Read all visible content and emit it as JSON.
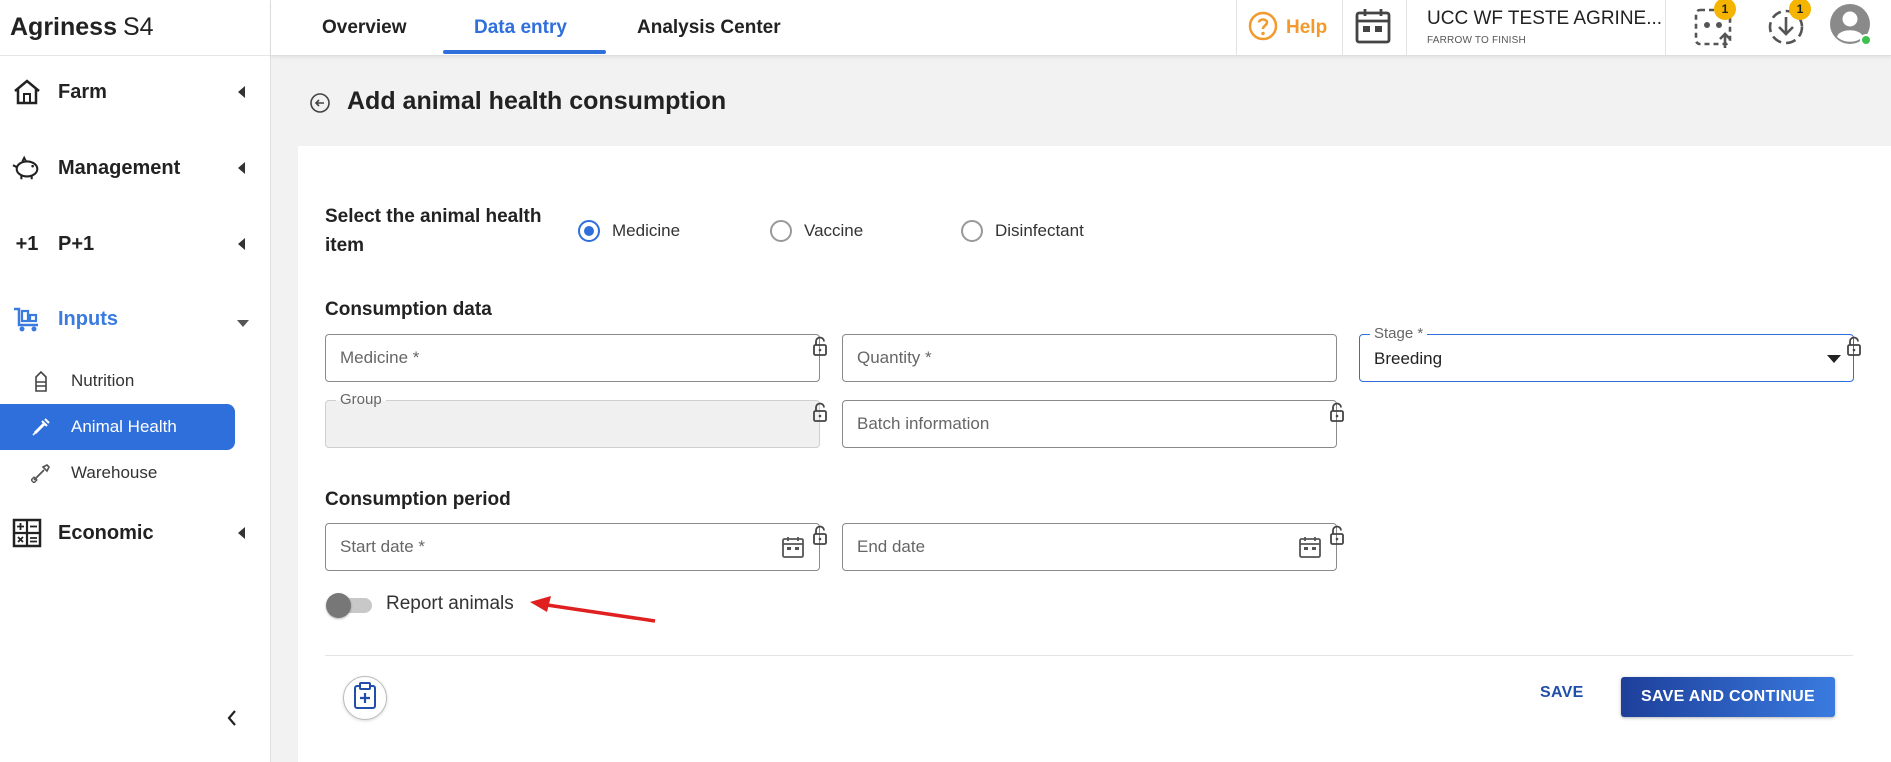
{
  "brand": {
    "name": "Agriness",
    "suffix": "S4"
  },
  "sidebar": {
    "items": [
      {
        "label": "Farm",
        "icon": "house-icon"
      },
      {
        "label": "Management",
        "icon": "pig-icon"
      },
      {
        "label": "P+1",
        "icon": "plus-one-icon"
      },
      {
        "label": "Inputs",
        "icon": "cart-icon"
      },
      {
        "label": "Economic",
        "icon": "calculator-icon"
      }
    ],
    "sub_items": [
      {
        "label": "Nutrition",
        "icon": "silo-icon"
      },
      {
        "label": "Animal Health",
        "icon": "syringe-icon"
      },
      {
        "label": "Warehouse",
        "icon": "shovel-icon"
      }
    ]
  },
  "topbar": {
    "tabs": [
      {
        "label": "Overview"
      },
      {
        "label": "Data entry"
      },
      {
        "label": "Analysis Center"
      }
    ],
    "help_label": "Help",
    "farm_name": "UCC WF TESTE AGRINE...",
    "farm_type": "FARROW TO FINISH",
    "upload_badge": "1",
    "download_badge": "1"
  },
  "page": {
    "title": "Add animal health consumption"
  },
  "form": {
    "item_type_label": "Select the animal health item",
    "item_type_options": [
      {
        "label": "Medicine",
        "checked": true
      },
      {
        "label": "Vaccine",
        "checked": false
      },
      {
        "label": "Disinfectant",
        "checked": false
      }
    ],
    "consumption_data_label": "Consumption data",
    "medicine_placeholder": "Medicine *",
    "quantity_placeholder": "Quantity *",
    "stage_label": "Stage *",
    "stage_value": "Breeding",
    "group_label": "Group",
    "batch_placeholder": "Batch information",
    "consumption_period_label": "Consumption period",
    "start_date_placeholder": "Start date *",
    "end_date_placeholder": "End date",
    "report_animals_label": "Report animals",
    "report_animals_on": false
  },
  "actions": {
    "save": "SAVE",
    "save_continue": "SAVE AND CONTINUE"
  },
  "colors": {
    "accent": "#2f6fdc",
    "help": "#f29a2e",
    "badge": "#f4b400",
    "annotation_arrow": "#e02020"
  }
}
